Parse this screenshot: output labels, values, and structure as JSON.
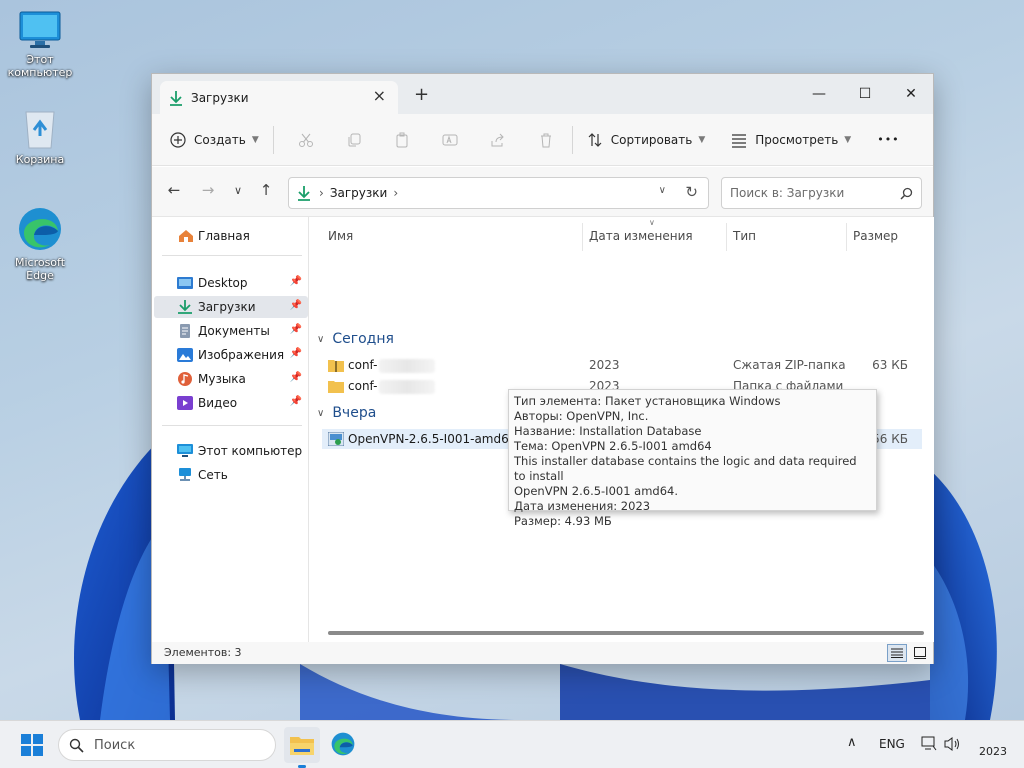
{
  "desktop": {
    "icons": [
      {
        "label": "Этот компьютер",
        "icon": "monitor-icon"
      },
      {
        "label": "Корзина",
        "icon": "recycle-bin-icon"
      },
      {
        "label": "Microsoft Edge",
        "icon": "edge-icon"
      }
    ]
  },
  "window": {
    "tab_title": "Загрузки",
    "tab_close": "×",
    "new_tab": "+",
    "controls": {
      "minimize": "—",
      "maximize": "☐",
      "close": "✕"
    }
  },
  "toolbar": {
    "create_label": "Создать",
    "sort_label": "Сортировать",
    "view_label": "Просмотреть",
    "more_label": "•••"
  },
  "address": {
    "crumb": "Загрузки",
    "search_placeholder": "Поиск в: Загрузки"
  },
  "sidebar": {
    "home": "Главная",
    "items": [
      {
        "label": "Desktop",
        "icon": "desktop-icon",
        "color": "#2d7bd1"
      },
      {
        "label": "Загрузки",
        "icon": "download-icon",
        "color": "#1a9e6a"
      },
      {
        "label": "Документы",
        "icon": "documents-icon",
        "color": "#6b7a90"
      },
      {
        "label": "Изображения",
        "icon": "pictures-icon",
        "color": "#2a7bd8"
      },
      {
        "label": "Музыка",
        "icon": "music-icon",
        "color": "#e0603a"
      },
      {
        "label": "Видео",
        "icon": "video-icon",
        "color": "#7a3fd0"
      }
    ],
    "this_pc": "Этот компьютер",
    "network": "Сеть"
  },
  "columns": {
    "name": "Имя",
    "date": "Дата изменения",
    "type": "Тип",
    "size": "Размер"
  },
  "groups": {
    "today": "Сегодня",
    "yesterday": "Вчера"
  },
  "files": [
    {
      "name": "conf-",
      "date": "2023",
      "type": "Сжатая ZIP-папка",
      "size": "63 КБ",
      "icon": "zip-folder-icon"
    },
    {
      "name": "conf-",
      "date": "2023",
      "type": "Папка с файлами",
      "size": "",
      "icon": "folder-icon"
    },
    {
      "name": "OpenVPN-2.6.5-I001-amd64",
      "date": "2023",
      "type": "Пакет установщи...",
      "size": "5,056 КБ",
      "icon": "installer-icon"
    }
  ],
  "tooltip": {
    "lines": [
      "Тип элемента: Пакет установщика Windows",
      "Авторы: OpenVPN, Inc.",
      "Название: Installation Database",
      "Тема: OpenVPN 2.6.5-I001 amd64",
      "This installer database contains the logic and data required to install",
      "OpenVPN 2.6.5-I001 amd64.",
      "Дата изменения: 2023",
      "Размер: 4.93 МБ"
    ]
  },
  "status": {
    "items_count": "Элементов: 3"
  },
  "taskbar": {
    "search_placeholder": "Поиск",
    "lang": "ENG",
    "clock": "2023"
  }
}
